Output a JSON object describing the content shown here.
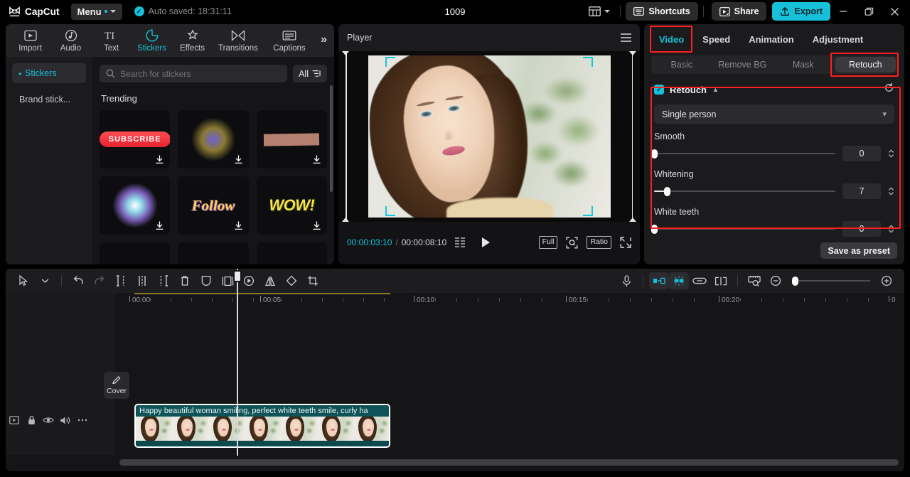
{
  "titlebar": {
    "brand": "CapCut",
    "menu_label": "Menu",
    "autosave": "Auto saved: 18:31:11",
    "project_title": "1009",
    "shortcuts_label": "Shortcuts",
    "share_label": "Share",
    "export_label": "Export",
    "icons": {
      "layout": "layout-icon",
      "minimize": "minimize-icon",
      "maximize": "maximize-icon",
      "close": "close-icon"
    }
  },
  "left_panel": {
    "tabs": [
      {
        "label": "Import",
        "icon": "import-icon",
        "active": false
      },
      {
        "label": "Audio",
        "icon": "audio-icon",
        "active": false
      },
      {
        "label": "Text",
        "icon": "text-icon",
        "active": false
      },
      {
        "label": "Stickers",
        "icon": "stickers-icon",
        "active": true
      },
      {
        "label": "Effects",
        "icon": "effects-icon",
        "active": false
      },
      {
        "label": "Transitions",
        "icon": "transitions-icon",
        "active": false
      },
      {
        "label": "Captions",
        "icon": "captions-icon",
        "active": false
      }
    ],
    "more_label": "»",
    "categories": [
      {
        "label": "Stickers",
        "active": true
      },
      {
        "label": "Brand stick...",
        "active": false
      }
    ],
    "search_placeholder": "Search for stickers",
    "search_value": "",
    "filter_label": "All",
    "section_title": "Trending",
    "stickers": [
      {
        "name": "subscribe-sticker",
        "caption": "SUBSCRIBE"
      },
      {
        "name": "firework-sticker",
        "caption": ""
      },
      {
        "name": "tape-sticker",
        "caption": ""
      },
      {
        "name": "sparkle-burst-sticker",
        "caption": ""
      },
      {
        "name": "follow-sticker",
        "caption": "Follow"
      },
      {
        "name": "wow-sticker",
        "caption": "WOW!"
      }
    ]
  },
  "player": {
    "title": "Player",
    "current_time": "00:00:03:10",
    "total_time": "00:00:08:10",
    "separator": "/",
    "full_label": "Full",
    "ratio_label": "Ratio",
    "icons": {
      "menu": "hamburger-icon",
      "play": "play-icon",
      "frames": "frames-icon",
      "crop": "crop-focus-icon",
      "fullscreen": "fullscreen-icon"
    }
  },
  "right_panel": {
    "tabs": [
      {
        "label": "Video",
        "active": true,
        "highlighted": true
      },
      {
        "label": "Speed",
        "active": false,
        "highlighted": false
      },
      {
        "label": "Animation",
        "active": false,
        "highlighted": false
      },
      {
        "label": "Adjustment",
        "active": false,
        "highlighted": false
      }
    ],
    "segments": [
      {
        "label": "Basic",
        "active": false,
        "highlighted": false
      },
      {
        "label": "Remove BG",
        "active": false,
        "highlighted": false
      },
      {
        "label": "Mask",
        "active": false,
        "highlighted": false
      },
      {
        "label": "Retouch",
        "active": true,
        "highlighted": true
      }
    ],
    "retouch": {
      "section_title": "Retouch",
      "enabled": true,
      "mode_value": "Single person",
      "sliders": [
        {
          "label": "Smooth",
          "value": "0",
          "percent": 0
        },
        {
          "label": "Whitening",
          "value": "7",
          "percent": 7
        },
        {
          "label": "White teeth",
          "value": "0",
          "percent": 0
        }
      ]
    },
    "save_preset_label": "Save as preset"
  },
  "timeline": {
    "toolbar_left_icons": [
      "select-tool-icon",
      "tool-dropdown-icon",
      "undo-icon",
      "redo-icon",
      "split-left-icon",
      "split-icon",
      "split-right-icon",
      "delete-icon",
      "mask-shape-icon",
      "freeze-icon",
      "keyframe-icon",
      "mirror-icon",
      "rotate-icon",
      "crop-icon"
    ],
    "toolbar_right_icons": [
      "microphone-icon",
      "auto-cut-icon",
      "auto-beat-icon",
      "link-icon",
      "separate-icon",
      "preview-ruler-icon",
      "zoom-out-icon",
      "zoom-in-icon"
    ],
    "ruler_labels": [
      "00:00",
      "00:05",
      "00:10",
      "00:15",
      "00:20",
      "0"
    ],
    "track_icons": [
      "video-track-icon",
      "lock-icon",
      "eye-icon",
      "volume-icon",
      "more-icon"
    ],
    "cover_label": "Cover",
    "clip": {
      "label": "Happy beautiful woman smiling, perfect white teeth smile, curly ha",
      "thumbnail_count": 7
    }
  },
  "colors": {
    "accent": "#15c0d8",
    "highlight": "#ff1f1f",
    "clip": "#0d4a4f",
    "panel_bg": "#1b1b1d",
    "app_bg": "#000000"
  }
}
